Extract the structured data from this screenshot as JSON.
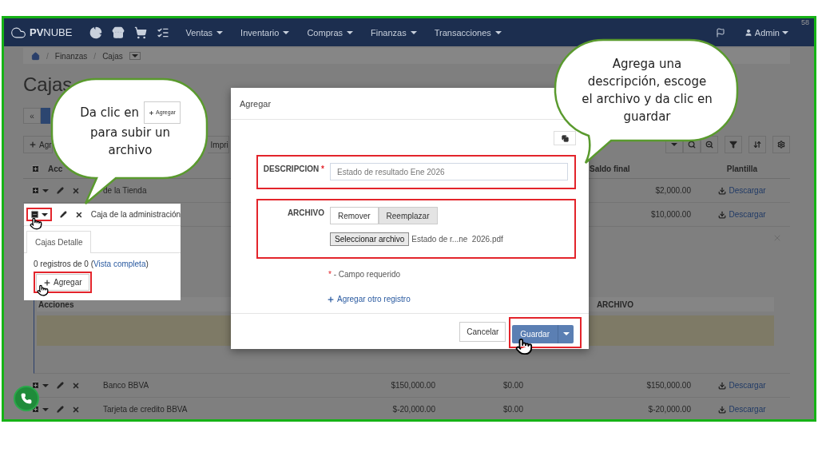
{
  "corner_number": "58",
  "navbar": {
    "logo_bold": "PV",
    "logo_rest": "NUBE",
    "menus": [
      "Ventas",
      "Inventario",
      "Compras",
      "Finanzas",
      "Transacciones"
    ],
    "user": "Admin"
  },
  "breadcrumb": [
    {
      "separator": "/",
      "label": "Finanzas"
    },
    {
      "separator": "/",
      "label": "Cajas"
    }
  ],
  "page_title": "Cajas",
  "pagination": {
    "first": "«"
  },
  "toolbar": {
    "add": "Agr",
    "print": "Impri"
  },
  "table": {
    "columns": {
      "actions": "Acc",
      "final_balance": "Saldo final",
      "template": "Plantilla"
    },
    "rows": [
      {
        "expanded": false,
        "name": "de la Tienda",
        "value_a": "",
        "value_b": "",
        "final_balance": "$2,000.00",
        "template": "Descargar"
      },
      {
        "expanded": true,
        "name": "",
        "value_a": "",
        "value_b": "",
        "final_balance": "$10,000.00",
        "template": "Descargar"
      },
      {
        "expanded": false,
        "name": "Banco BBVA",
        "value_a": "$150,000.00",
        "value_b": "$0.00",
        "final_balance": "$150,000.00",
        "template": "Descargar"
      },
      {
        "expanded": false,
        "name": "Tarjeta de credito BBVA",
        "value_a": "$-20,000.00",
        "value_b": "$0.00",
        "final_balance": "$-20,000.00",
        "template": "Descargar"
      }
    ]
  },
  "detail": {
    "columns": [
      "Acciones",
      "ARCHIVO"
    ]
  },
  "highlight": {
    "expanded": true,
    "name": "Caja de la administración",
    "tab": "Cajas Detalle",
    "count_text": "0 registros de 0 (",
    "link": "Vista completa",
    "count_end": ")",
    "add_button": "Agregar"
  },
  "modal": {
    "title": "Agregar",
    "fields": [
      {
        "kind": "text",
        "label": "DESCRIPCION",
        "required_mark": "*",
        "value": "Estado de resultado Ene 2026"
      },
      {
        "kind": "file",
        "label": "ARCHIVO",
        "buttons": [
          {
            "label": "Remover",
            "selected": false
          },
          {
            "label": "Reemplazar",
            "selected": true
          }
        ],
        "choose_button": "Seleccionar archivo",
        "file_name": "Estado de r...ne  2026.pdf"
      }
    ],
    "required_mark": "*",
    "required_note": "- Campo requerido",
    "add_another": "Agregar otro registro",
    "cancel": "Cancelar",
    "save": "Guardar"
  },
  "callouts": {
    "left": {
      "before": "Da clic en",
      "button": "Agregar",
      "after": "para subir un archivo"
    },
    "right": {
      "text": "Agrega una descripción, escoge el archivo y da clic en guardar"
    }
  }
}
